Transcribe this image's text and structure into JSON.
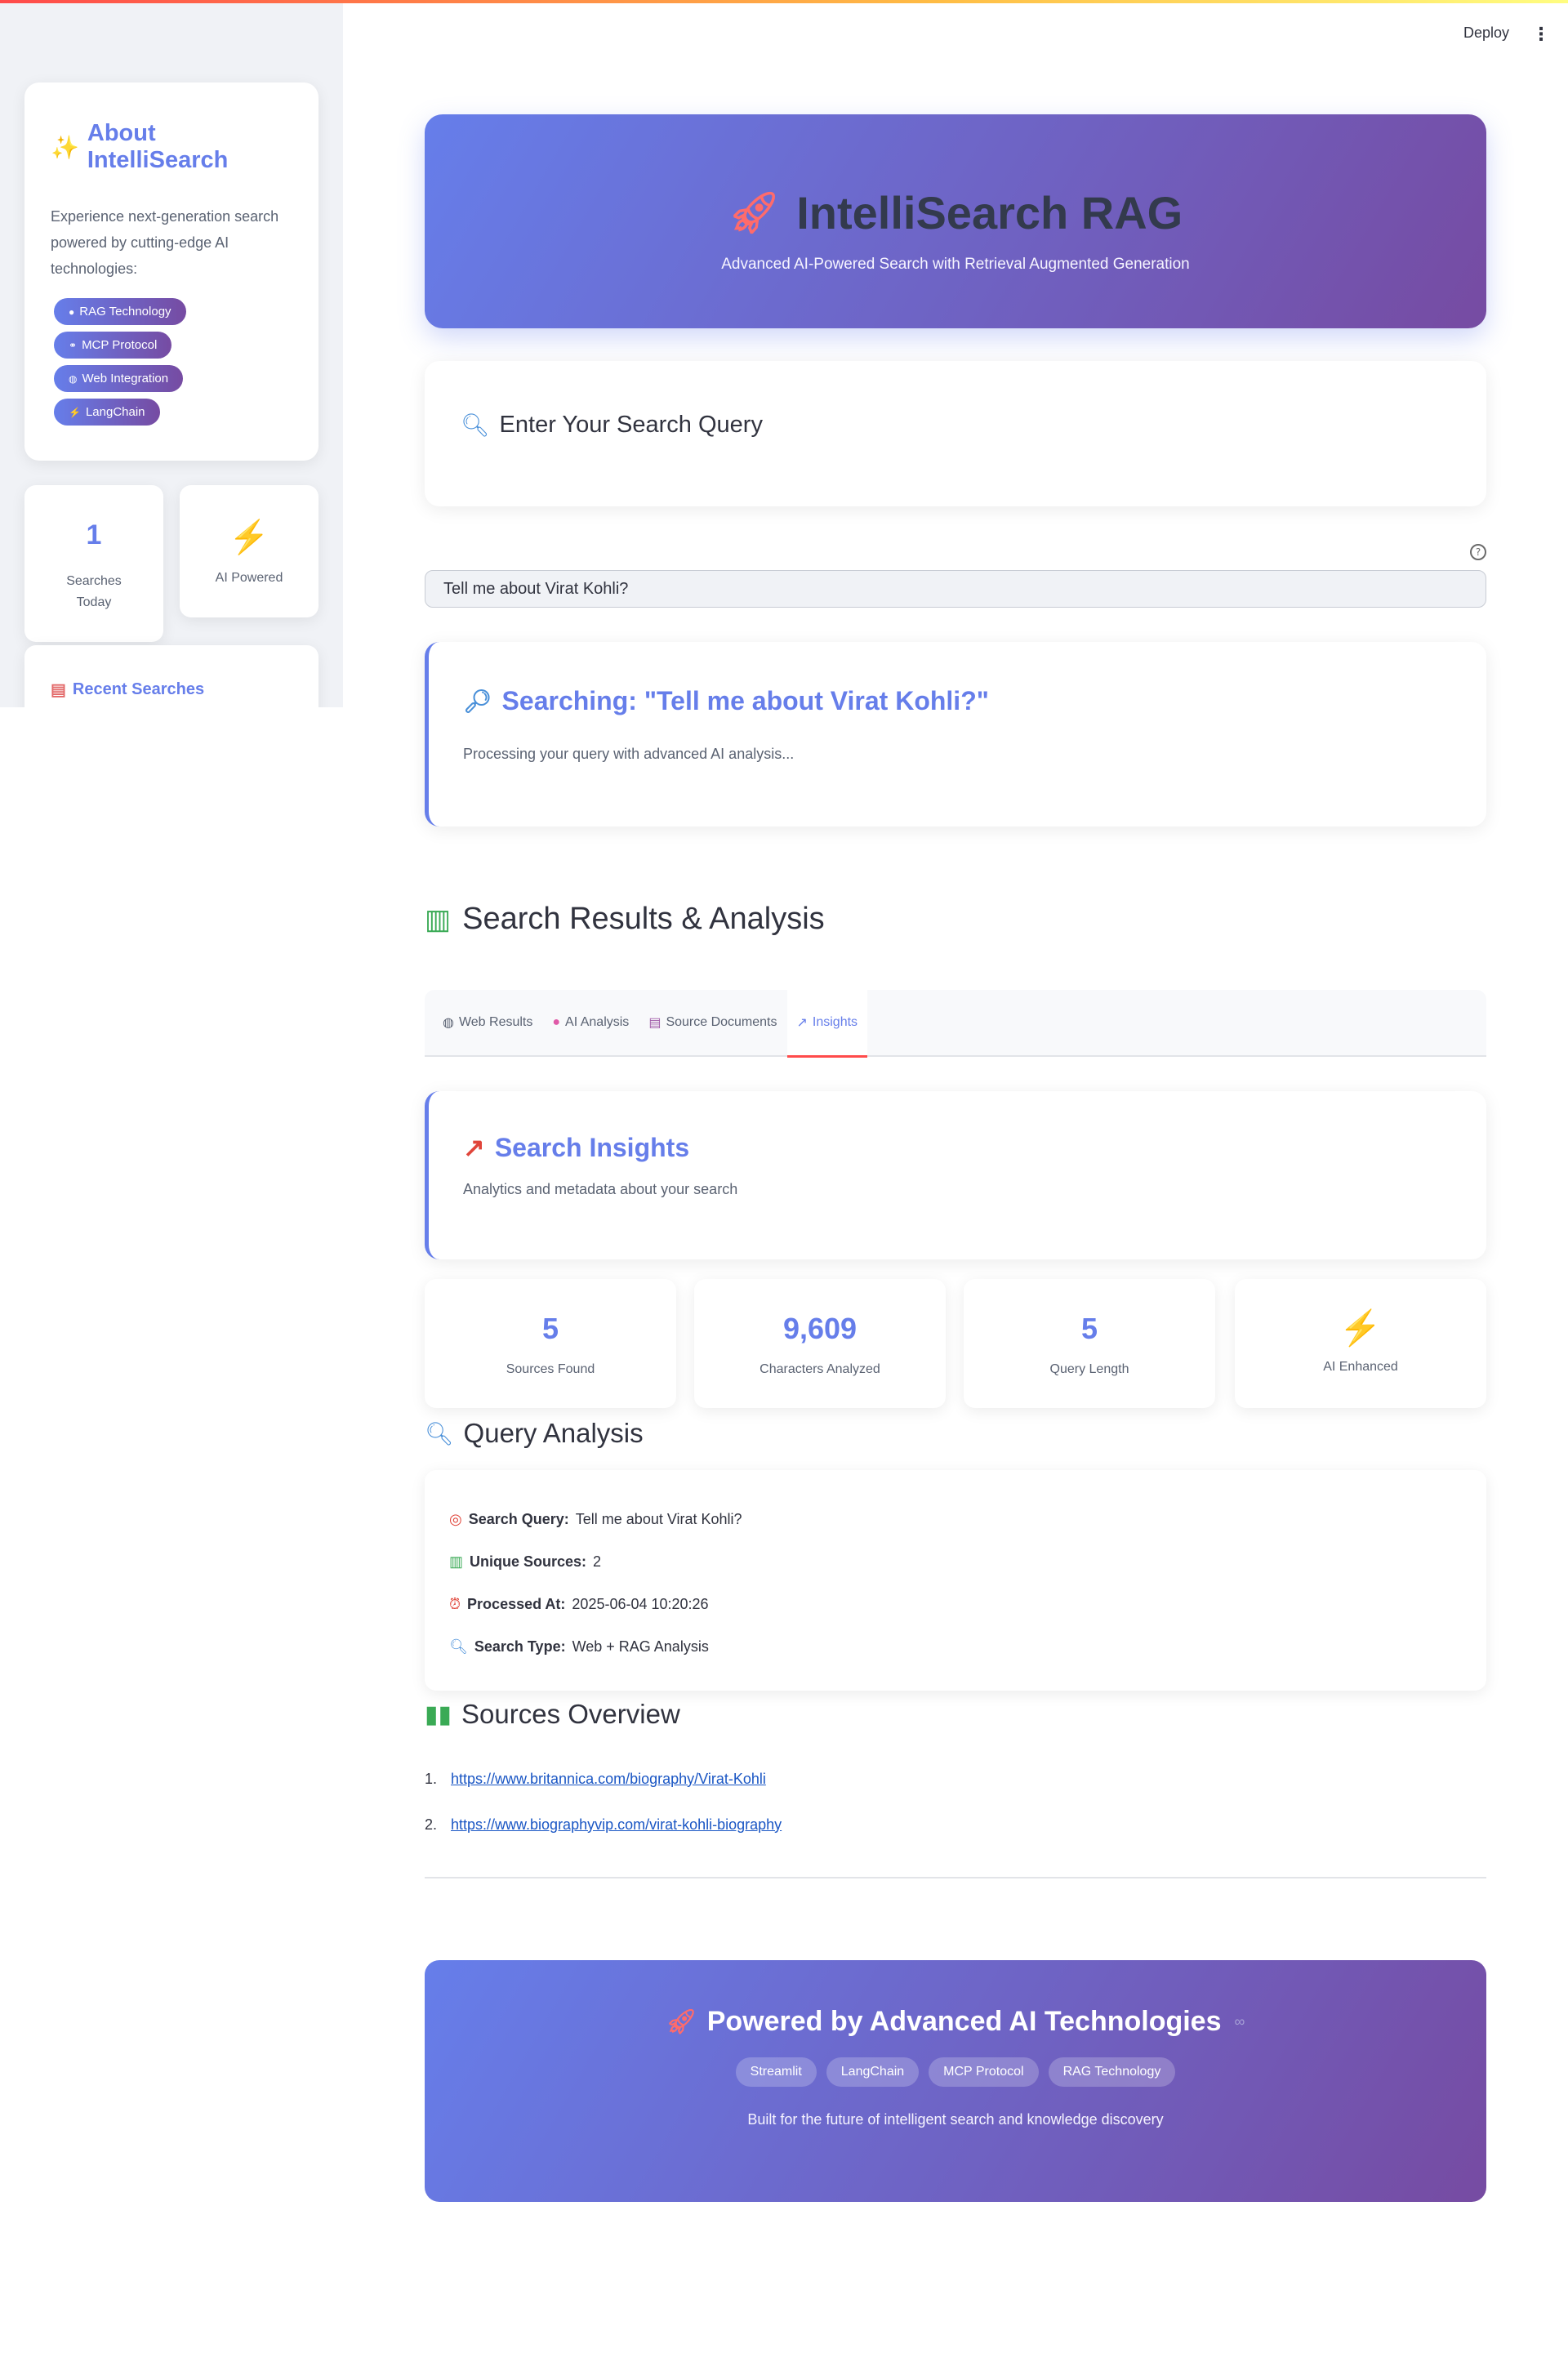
{
  "toolbar": {
    "deploy_label": "Deploy",
    "menu_icon": "kebab-menu-icon"
  },
  "sidebar": {
    "about": {
      "icon": "sparkles-icon",
      "title": "About IntelliSearch",
      "description": "Experience next-generation search powered by cutting-edge AI technologies:",
      "pills": [
        {
          "icon": "brain-icon",
          "label": "RAG Technology"
        },
        {
          "icon": "link-icon",
          "label": "MCP Protocol"
        },
        {
          "icon": "globe-icon",
          "label": "Web Integration"
        },
        {
          "icon": "lightning-icon",
          "label": "LangChain"
        }
      ]
    },
    "stats": {
      "searches_value": "1",
      "searches_label": "Searches Today",
      "ai_label": "AI Powered"
    },
    "recent": {
      "title": "Recent Searches"
    }
  },
  "hero": {
    "title": "IntelliSearch RAG",
    "subtitle": "Advanced AI-Powered Search with Retrieval Augmented Generation"
  },
  "query": {
    "title": "Enter Your Search Query",
    "value": "Tell me about Virat Kohli?"
  },
  "searching": {
    "title": "Searching: \"Tell me about Virat Kohli?\"",
    "description": "Processing your query with advanced AI analysis..."
  },
  "results": {
    "title": "Search Results & Analysis",
    "tabs": [
      {
        "icon": "globe-icon",
        "label": "Web Results",
        "active": false
      },
      {
        "icon": "brain-icon",
        "label": "AI Analysis",
        "active": false
      },
      {
        "icon": "document-icon",
        "label": "Source Documents",
        "active": false
      },
      {
        "icon": "trend-icon",
        "label": "Insights",
        "active": true
      }
    ]
  },
  "insights": {
    "title": "Search Insights",
    "description": "Analytics and metadata about your search",
    "metrics": [
      {
        "value": "5",
        "label": "Sources Found"
      },
      {
        "value": "9,609",
        "label": "Characters Analyzed"
      },
      {
        "value": "5",
        "label": "Query Length"
      },
      {
        "value": "",
        "label": "AI Enhanced"
      }
    ]
  },
  "query_analysis": {
    "title": "Query Analysis",
    "rows": [
      {
        "key": "Search Query:",
        "value": "Tell me about Virat Kohli?"
      },
      {
        "key": "Unique Sources:",
        "value": "2"
      },
      {
        "key": "Processed At:",
        "value": "2025-06-04 10:20:26"
      },
      {
        "key": "Search Type:",
        "value": "Web + RAG Analysis"
      }
    ]
  },
  "sources": {
    "title": "Sources Overview",
    "items": [
      {
        "num": "1.",
        "url": "https://www.britannica.com/biography/Virat-Kohli"
      },
      {
        "num": "2.",
        "url": "https://www.biographyvip.com/virat-kohli-biography"
      }
    ]
  },
  "footer": {
    "title": "Powered by Advanced AI Technologies",
    "pills": [
      "Streamlit",
      "LangChain",
      "MCP Protocol",
      "RAG Technology"
    ],
    "subtitle": "Built for the future of intelligent search and knowledge discovery"
  },
  "colors": {
    "accent": "#667eea",
    "gradient_end": "#764ba2",
    "tab_underline": "#ff4b4b",
    "bolt": "#f5761a"
  }
}
